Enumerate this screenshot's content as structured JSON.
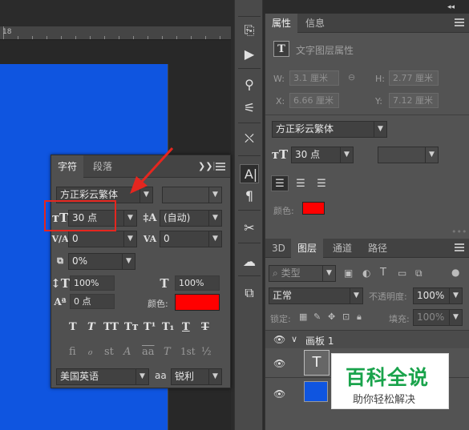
{
  "ruler": {
    "label": "18"
  },
  "top_collapse": "◂◂",
  "properties": {
    "tabs": [
      "属性",
      "信息"
    ],
    "section_title": "文字图层属性",
    "w_label": "W:",
    "w_value": "3.1 厘米",
    "h_label": "H:",
    "h_value": "2.77 厘米",
    "x_label": "X:",
    "x_value": "6.66 厘米",
    "y_label": "Y:",
    "y_value": "7.12 厘米",
    "font_family": "方正彩云繁体",
    "font_size": "30 点",
    "color_label": "颜色:"
  },
  "layers": {
    "tabs": [
      "3D",
      "图层",
      "通道",
      "路径"
    ],
    "filter_kind": "类型",
    "blend_mode": "正常",
    "opacity_label": "不透明度:",
    "opacity_value": "100%",
    "lock_label": "锁定:",
    "fill_label": "填充:",
    "fill_value": "100%",
    "artboard_name": "画板 1",
    "text_thumb": "T"
  },
  "character": {
    "tabs": [
      "字符",
      "段落"
    ],
    "font_family": "方正彩云繁体",
    "font_size": "30 点",
    "leading": "(自动)",
    "kerning": "0",
    "tracking": "0",
    "vscale": "0%",
    "scale_v": "100%",
    "scale_h": "100%",
    "baseline": "0 点",
    "color_label": "颜色:",
    "language": "美国英语",
    "aa_label": "aa",
    "antialias": "锐利",
    "styles": [
      "T",
      "T",
      "TT",
      "Tт",
      "T¹",
      "T₁",
      "T",
      "T"
    ],
    "opentype": [
      "fi",
      "ℴ",
      "st",
      "A",
      "aa",
      "T",
      "1st",
      "½"
    ]
  },
  "watermark": {
    "title": "百科全说",
    "subtitle": "助你轻松解决"
  },
  "colors": {
    "text_color": "#ff0000",
    "artboard": "#0f55e0",
    "highlight": "#e5261f"
  }
}
